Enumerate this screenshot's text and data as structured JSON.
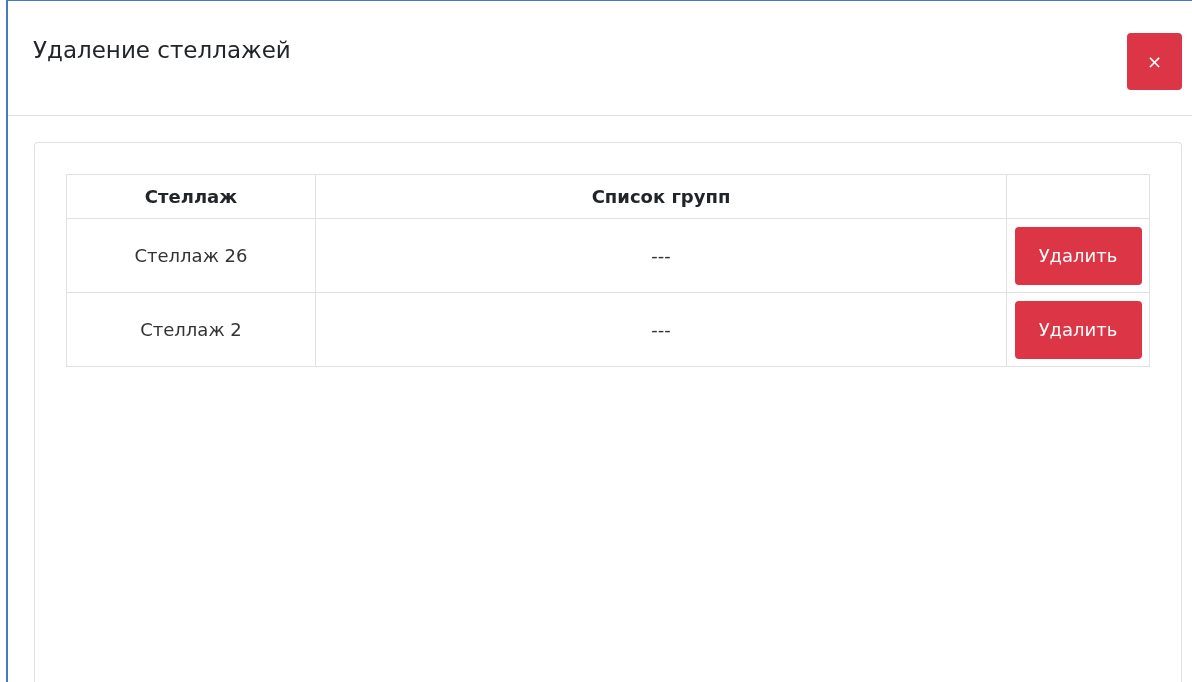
{
  "modal": {
    "title": "Удаление стеллажей",
    "close": "×"
  },
  "table": {
    "columns": [
      "Стеллаж",
      "Список групп",
      ""
    ],
    "rows": [
      {
        "rack": "Стеллаж 26",
        "groups": "---",
        "action": "Удалить"
      },
      {
        "rack": "Стеллаж 2",
        "groups": "---",
        "action": "Удалить"
      }
    ]
  }
}
